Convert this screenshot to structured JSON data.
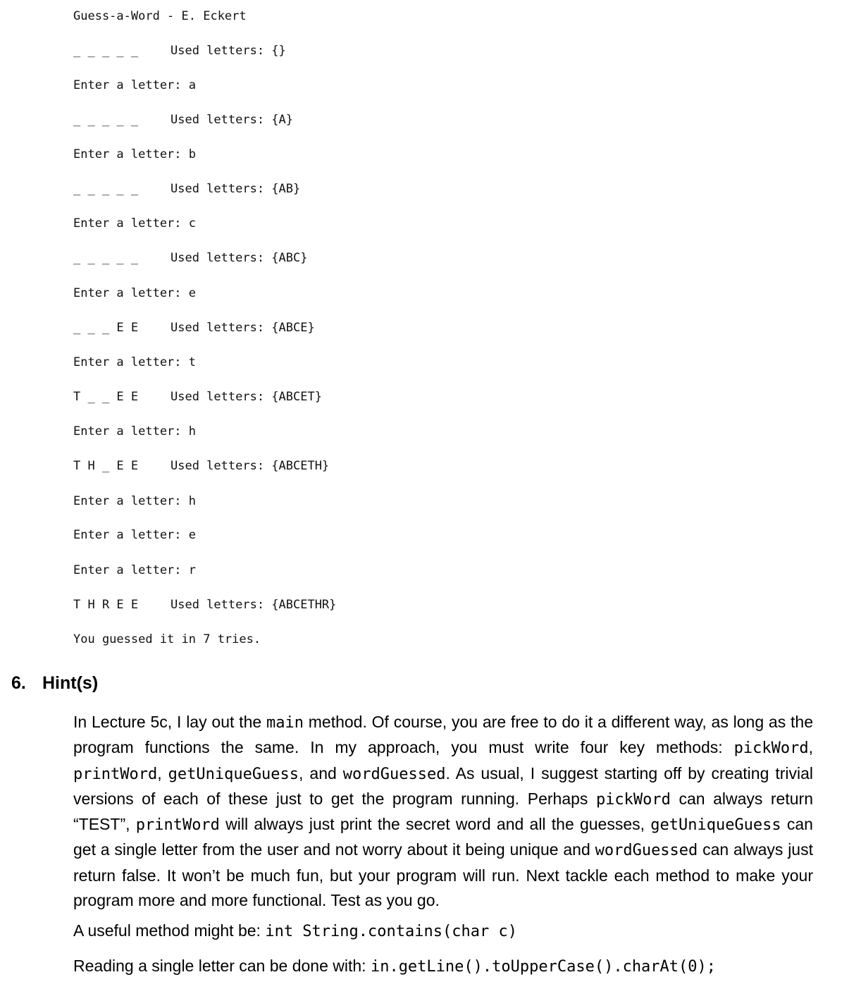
{
  "console": {
    "title": "Guess-a-Word - E. Eckert",
    "lines": [
      {
        "type": "state",
        "word": "_ _ _ _ _",
        "used": "Used letters: {}"
      },
      {
        "type": "prompt",
        "text": "Enter a letter: a"
      },
      {
        "type": "state",
        "word": "_ _ _ _ _",
        "used": "Used letters: {A}"
      },
      {
        "type": "prompt",
        "text": "Enter a letter: b"
      },
      {
        "type": "state",
        "word": "_ _ _ _ _",
        "used": "Used letters: {AB}"
      },
      {
        "type": "prompt",
        "text": "Enter a letter: c"
      },
      {
        "type": "state",
        "word": "_ _ _ _ _",
        "used": "Used letters: {ABC}"
      },
      {
        "type": "prompt",
        "text": "Enter a letter: e"
      },
      {
        "type": "state",
        "word": "_ _ _ E E",
        "used": "Used letters: {ABCE}"
      },
      {
        "type": "prompt",
        "text": "Enter a letter: t"
      },
      {
        "type": "state",
        "word": "T _ _ E E",
        "used": "Used letters: {ABCET}"
      },
      {
        "type": "prompt",
        "text": "Enter a letter: h"
      },
      {
        "type": "state",
        "word": "T H _ E E",
        "used": "Used letters: {ABCETH}"
      },
      {
        "type": "prompt",
        "text": "Enter a letter: h"
      },
      {
        "type": "prompt",
        "text": "Enter a letter: e"
      },
      {
        "type": "prompt",
        "text": "Enter a letter: r"
      },
      {
        "type": "state",
        "word": "T H R E E",
        "used": "Used letters: {ABCETHR}"
      },
      {
        "type": "prompt",
        "text": "You guessed it in 7 tries."
      }
    ]
  },
  "section": {
    "number": "6.",
    "title": "Hint(s)"
  },
  "hint": {
    "p1": [
      {
        "t": "In Lecture 5c, I lay out the "
      },
      {
        "c": "main"
      },
      {
        "t": " method. Of course, you are free to do it a different way, as long as the program functions the same. In my approach, you must write four key methods: "
      },
      {
        "c": "pickWord"
      },
      {
        "t": ", "
      },
      {
        "c": "printWord"
      },
      {
        "t": ", "
      },
      {
        "c": "getUniqueGuess"
      },
      {
        "t": ", and "
      },
      {
        "c": "wordGuessed"
      },
      {
        "t": ". As usual, I suggest starting off by creating trivial versions of each of these just to get the program running. Perhaps "
      },
      {
        "c": "pickWord"
      },
      {
        "t": " can always return “TEST”, "
      },
      {
        "c": "printWord"
      },
      {
        "t": " will always just print the secret word and all the guesses, "
      },
      {
        "c": "getUniqueGuess"
      },
      {
        "t": " can get a single letter from the user and not worry about it being unique and "
      },
      {
        "c": "wordGuessed"
      },
      {
        "t": " can always just return false. It won’t be much fun, but your program will run. Next tackle each method to make your program more and more functional. Test as you go."
      }
    ],
    "p2_label": "A useful method might be: ",
    "p2_code": "int String.contains(char c)",
    "p3_label": "Reading a single letter can be done with: ",
    "p3_code": "in.getLine().toUpperCase().charAt(0);"
  }
}
